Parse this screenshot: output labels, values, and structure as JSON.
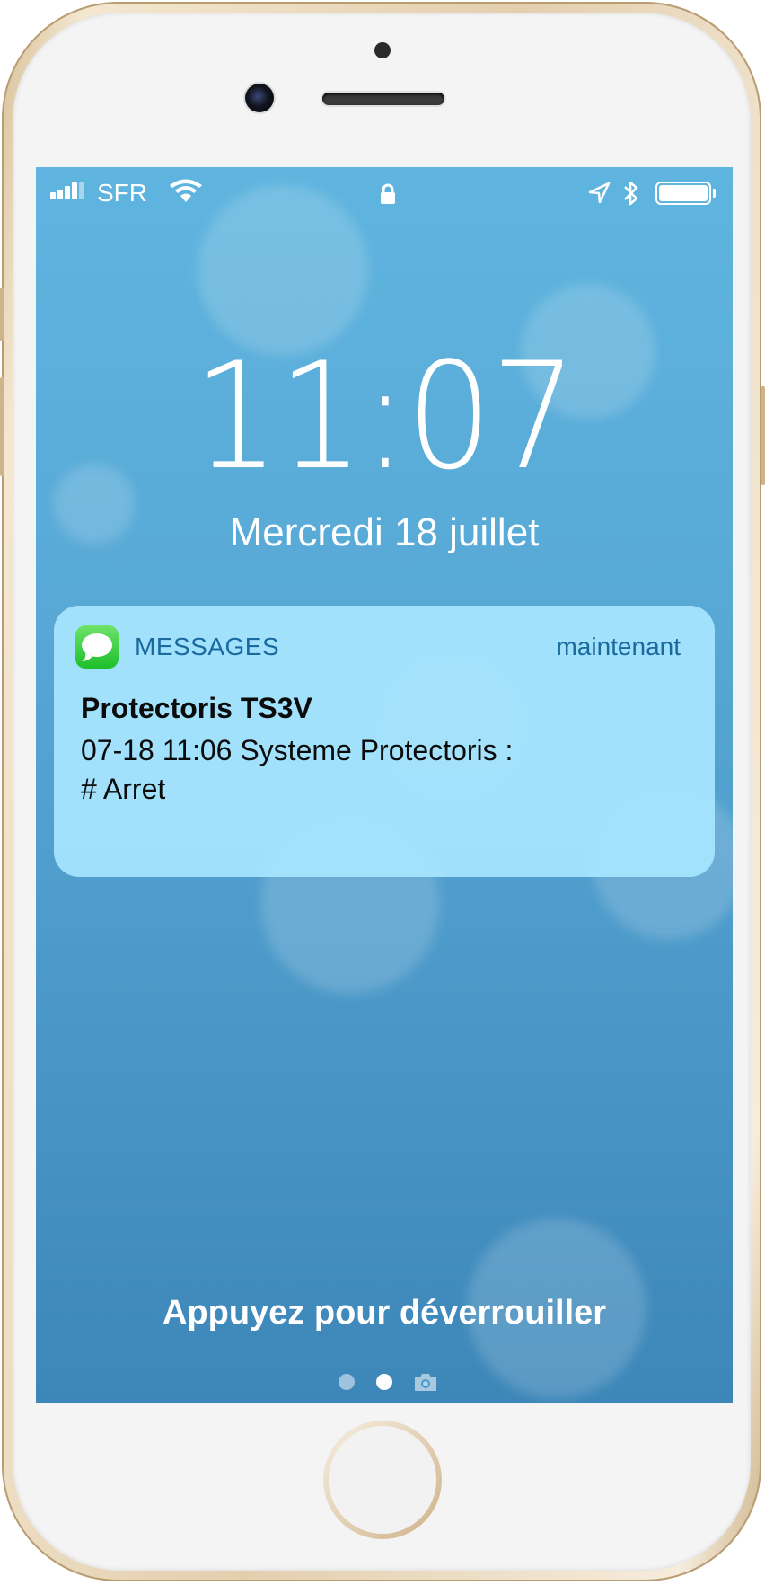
{
  "status_bar": {
    "carrier": "SFR",
    "battery_level": 1.0,
    "icons": [
      "signal-bars-icon",
      "wifi-icon",
      "lock-icon",
      "location-arrow-icon",
      "bluetooth-icon",
      "battery-icon"
    ]
  },
  "lock_screen": {
    "time": "11:07",
    "date": "Mercredi 18 juillet",
    "unlock_hint": "Appuyez pour déverrouiller",
    "page_dots_count": 2,
    "active_page": 2
  },
  "notification": {
    "app_name": "MESSAGES",
    "time": "maintenant",
    "title": "Protectoris TS3V",
    "body_line1": "07-18 11:06 Systeme Protectoris :",
    "body_line2": "# Arret",
    "app_icon": "messages-app-icon"
  },
  "colors": {
    "wallpaper_top": "#5fb5df",
    "wallpaper_bottom": "#3c86b8",
    "notification_bg": "#a8e6ff",
    "notification_accent": "#1a6aa0",
    "phone_frame": "#e3cfae"
  }
}
